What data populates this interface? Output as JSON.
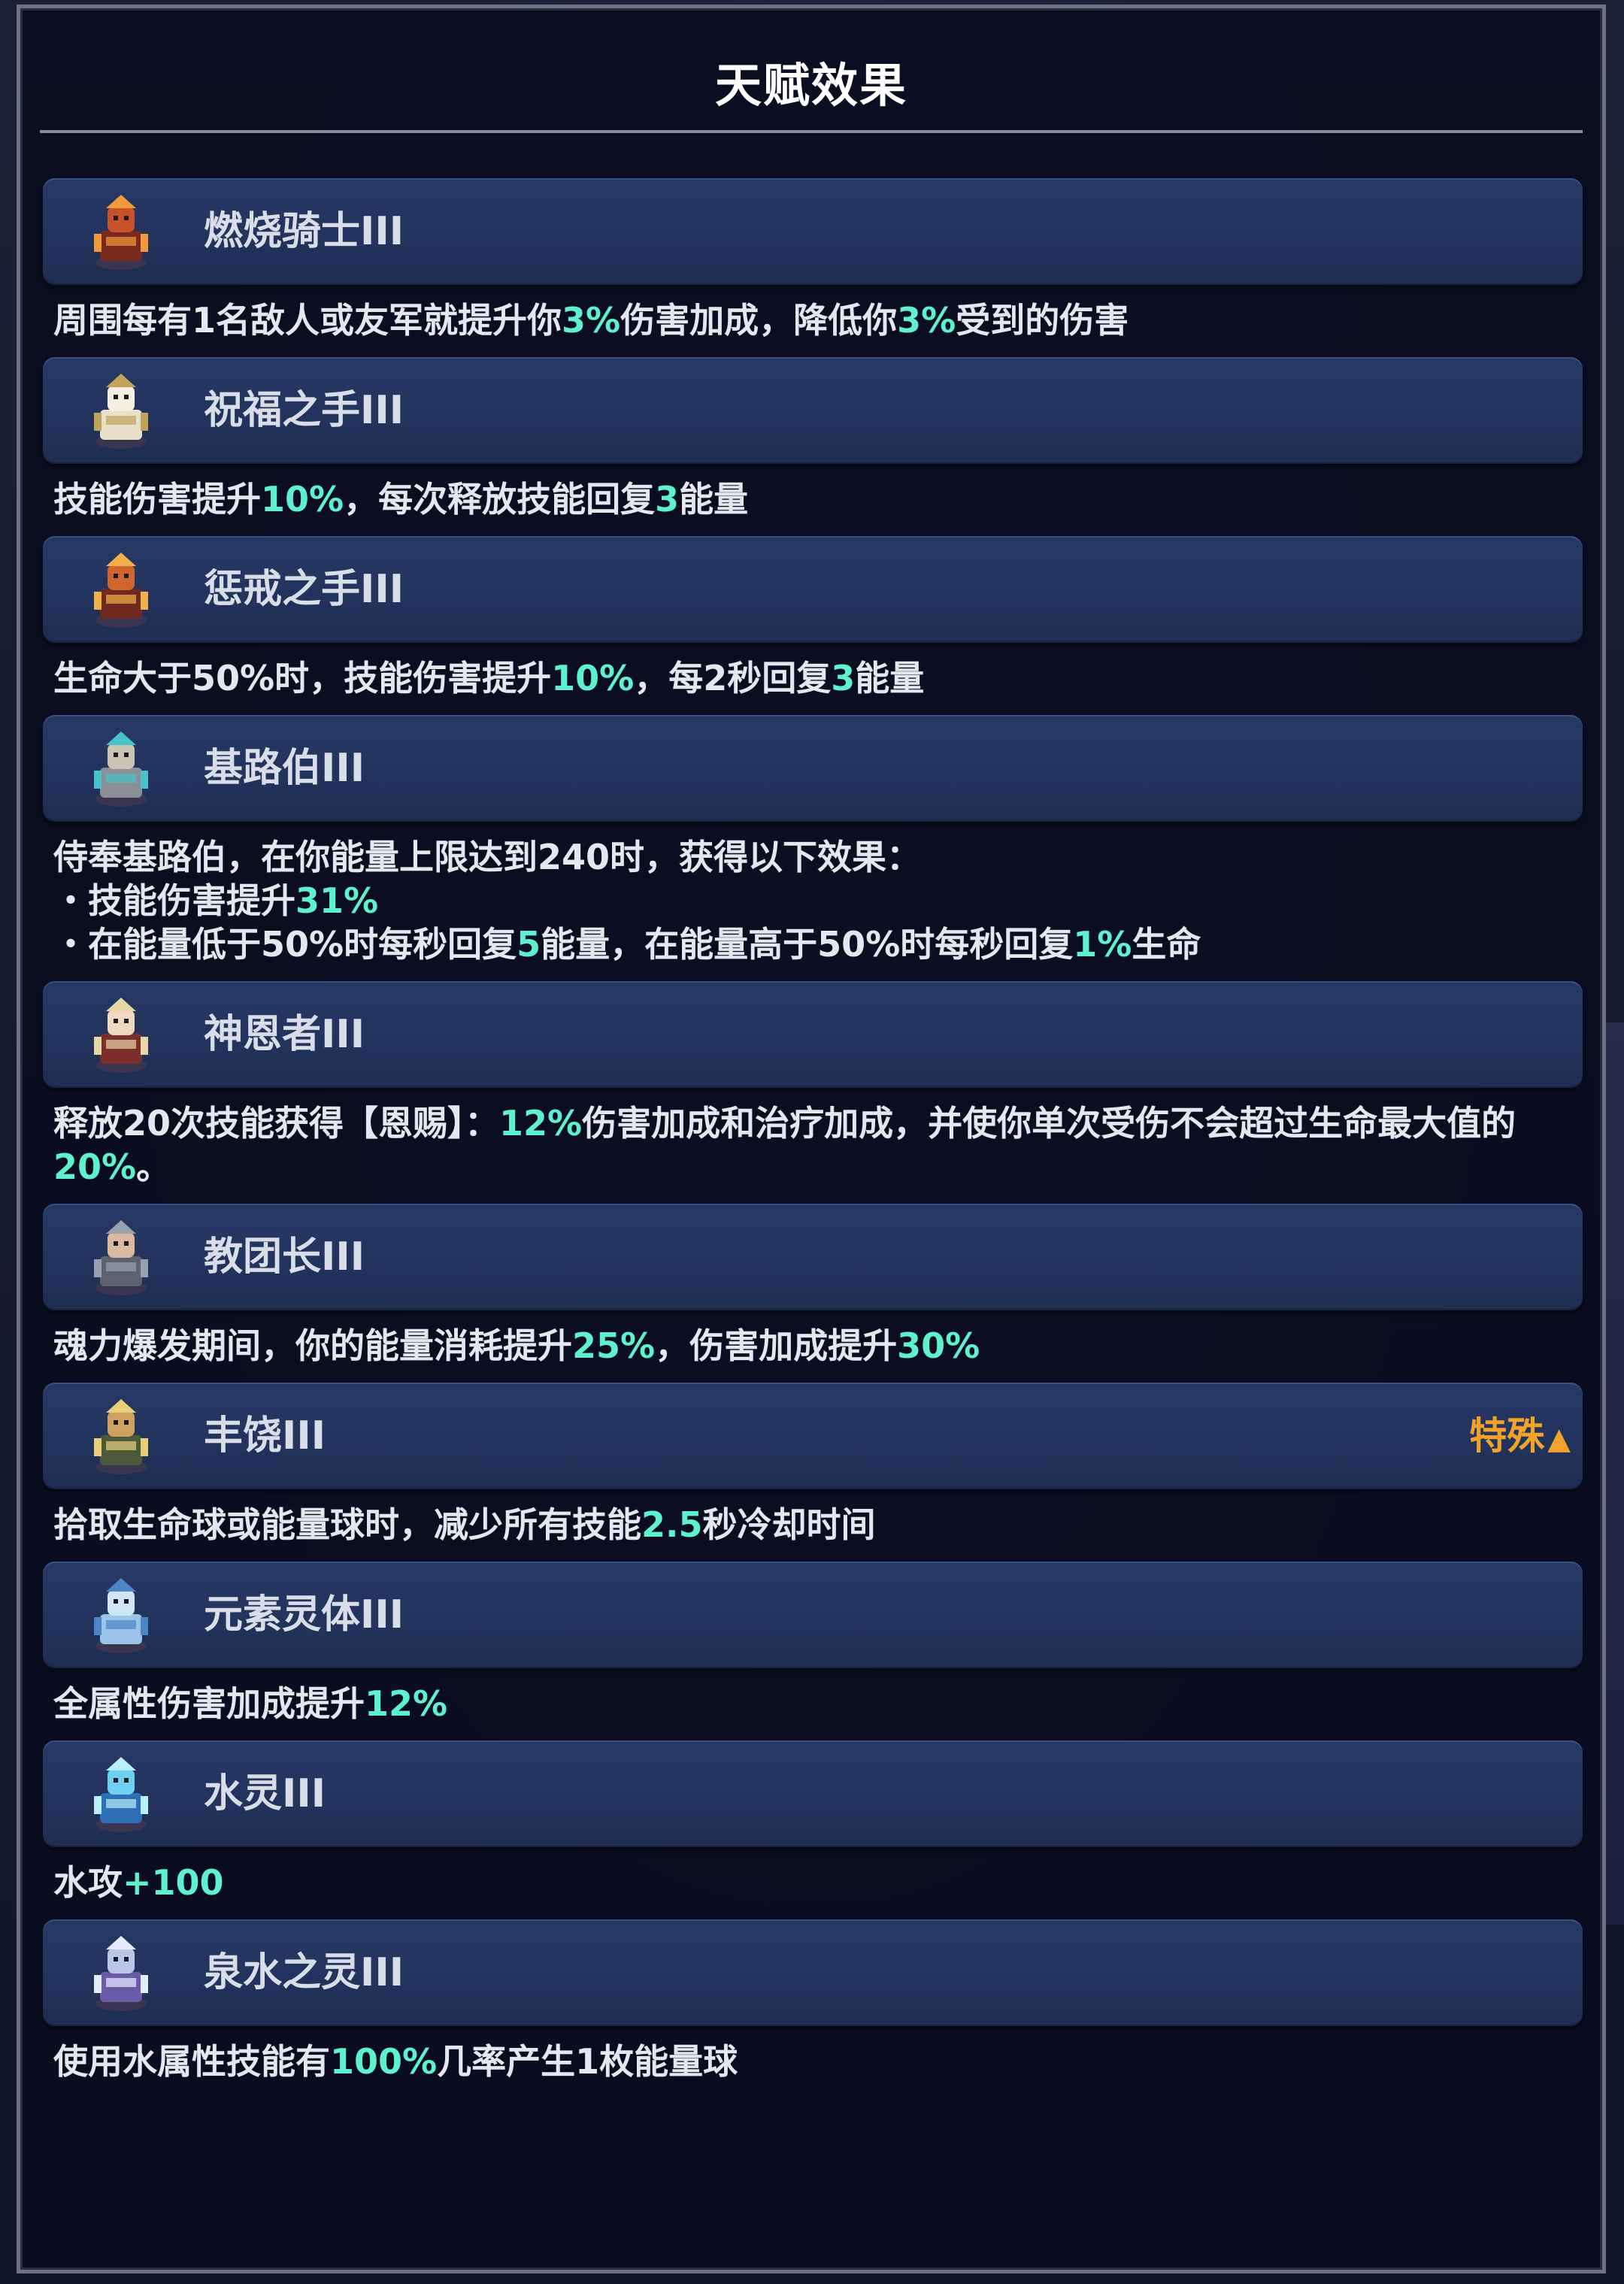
{
  "panel": {
    "title": "天赋效果"
  },
  "colors": {
    "highlight": "#5ef0cf",
    "special": "#f0a22a",
    "header": "#263965"
  },
  "talents": [
    {
      "icon": "burning-knight-icon",
      "name": "燃烧骑士III",
      "desc": [
        [
          "周围每有1名敌人或友军就提升你",
          false
        ],
        [
          "3%",
          true
        ],
        [
          "伤害加成，降低你",
          false
        ],
        [
          "3%",
          true
        ],
        [
          "受到的伤害",
          false
        ]
      ]
    },
    {
      "icon": "hand-of-blessing-icon",
      "name": "祝福之手III",
      "desc": [
        [
          "技能伤害提升",
          false
        ],
        [
          "10%",
          true
        ],
        [
          "，每次释放技能回复",
          false
        ],
        [
          "3",
          true
        ],
        [
          "能量",
          false
        ]
      ]
    },
    {
      "icon": "hand-of-punishment-icon",
      "name": "惩戒之手III",
      "desc": [
        [
          "生命大于50%时，技能伤害提升",
          false
        ],
        [
          "10%",
          true
        ],
        [
          "，每2秒回复",
          false
        ],
        [
          "3",
          true
        ],
        [
          "能量",
          false
        ]
      ]
    },
    {
      "icon": "kilrogg-icon",
      "name": "基路伯III",
      "desc": [
        [
          "侍奉基路伯，在你能量上限达到240时，获得以下效果：\n・技能伤害提升",
          false
        ],
        [
          "31%",
          true
        ],
        [
          "\n・在能量低于50%时每秒回复",
          false
        ],
        [
          "5",
          true
        ],
        [
          "能量，在能量高于50%时每秒回复",
          false
        ],
        [
          "1%",
          true
        ],
        [
          "生命",
          false
        ]
      ]
    },
    {
      "icon": "graced-one-icon",
      "name": "神恩者III",
      "desc": [
        [
          "释放20次技能获得【恩赐】：",
          false
        ],
        [
          "12%",
          true
        ],
        [
          "伤害加成和治疗加成，并使你单次受伤不会超过生命最大值的",
          false
        ],
        [
          "20%",
          true
        ],
        [
          "。",
          false
        ]
      ]
    },
    {
      "icon": "cult-leader-icon",
      "name": "教团长III",
      "desc": [
        [
          "魂力爆发期间，你的能量消耗提升",
          false
        ],
        [
          "25%",
          true
        ],
        [
          "，伤害加成提升",
          false
        ],
        [
          "30%",
          true
        ]
      ]
    },
    {
      "icon": "abundance-icon",
      "name": "丰饶III",
      "badge": "特殊",
      "badge_icon": "▲",
      "desc": [
        [
          "拾取生命球或能量球时，减少所有技能",
          false
        ],
        [
          "2.5",
          true
        ],
        [
          "秒冷却时间",
          false
        ]
      ]
    },
    {
      "icon": "elemental-spirit-icon",
      "name": "元素灵体III",
      "desc": [
        [
          "全属性伤害加成提升",
          false
        ],
        [
          "12%",
          true
        ]
      ]
    },
    {
      "icon": "water-spirit-icon",
      "name": "水灵III",
      "desc": [
        [
          "水攻",
          false
        ],
        [
          "+100",
          true
        ]
      ]
    },
    {
      "icon": "spring-spirit-icon",
      "name": "泉水之灵III",
      "desc": [
        [
          "使用水属性技能有",
          false
        ],
        [
          "100%",
          true
        ],
        [
          "几率产生1枚能量球",
          false
        ]
      ]
    }
  ]
}
